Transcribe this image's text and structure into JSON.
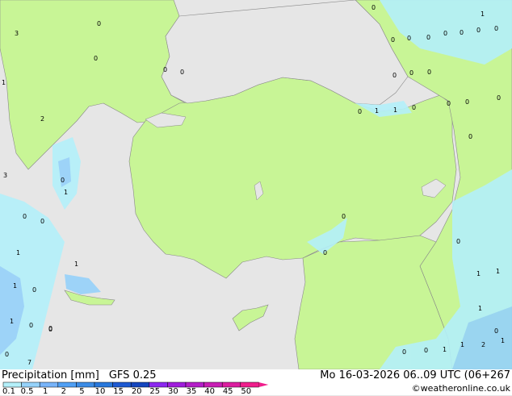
{
  "title": "Precipitation [mm]",
  "model": "GFS 0.25",
  "valid_time": "Mo 16-03-2026 06..09 UTC (06+267",
  "credit": "©weatheronline.co.uk",
  "legend": {
    "levels": [
      "0.1",
      "0.5",
      "1",
      "2",
      "5",
      "10",
      "15",
      "20",
      "25",
      "30",
      "35",
      "40",
      "45",
      "50"
    ],
    "colors": [
      "#b4f0fa",
      "#96d2fa",
      "#78b4fa",
      "#50a0f5",
      "#3c8ce6",
      "#2878dc",
      "#1e5ad2",
      "#1446be",
      "#8c28f0",
      "#a01edc",
      "#b41ec8",
      "#c81eb4",
      "#dc1ea0",
      "#f01e8c"
    ]
  },
  "colors": {
    "sea": "#e6e6e6",
    "land": "#c8f596",
    "precip_light": "#b4f0fa",
    "precip_mid": "#96d2fa",
    "precip_heavy": "#78b4fa",
    "border": "#888888"
  },
  "map_labels": [
    {
      "text": "0"
    },
    {
      "text": "0"
    },
    {
      "text": "0"
    },
    {
      "text": "0"
    },
    {
      "text": "0"
    },
    {
      "text": "0"
    },
    {
      "text": "0"
    },
    {
      "text": "0"
    },
    {
      "text": "0"
    },
    {
      "text": "0"
    },
    {
      "text": "0"
    },
    {
      "text": "0"
    },
    {
      "text": "0"
    },
    {
      "text": "0"
    },
    {
      "text": "0"
    },
    {
      "text": "0"
    },
    {
      "text": "0"
    },
    {
      "text": "0"
    },
    {
      "text": "1"
    },
    {
      "text": "1"
    },
    {
      "text": "0"
    },
    {
      "text": "0"
    },
    {
      "text": "0"
    },
    {
      "text": "0"
    },
    {
      "text": "0"
    },
    {
      "text": "0"
    },
    {
      "text": "1"
    },
    {
      "text": "0"
    },
    {
      "text": "0"
    },
    {
      "text": "0"
    },
    {
      "text": "1"
    },
    {
      "text": "0"
    },
    {
      "text": "0"
    },
    {
      "text": "1"
    },
    {
      "text": "1"
    },
    {
      "text": "0"
    },
    {
      "text": "1"
    },
    {
      "text": "0"
    },
    {
      "text": "1"
    },
    {
      "text": "1"
    },
    {
      "text": "0"
    },
    {
      "text": "0"
    },
    {
      "text": "1"
    },
    {
      "text": "1"
    },
    {
      "text": "2"
    },
    {
      "text": "1"
    },
    {
      "text": "1"
    },
    {
      "text": "0"
    },
    {
      "text": "3"
    },
    {
      "text": "3"
    },
    {
      "text": "1"
    },
    {
      "text": "2"
    },
    {
      "text": "7"
    },
    {
      "text": "0"
    },
    {
      "text": "1"
    }
  ]
}
